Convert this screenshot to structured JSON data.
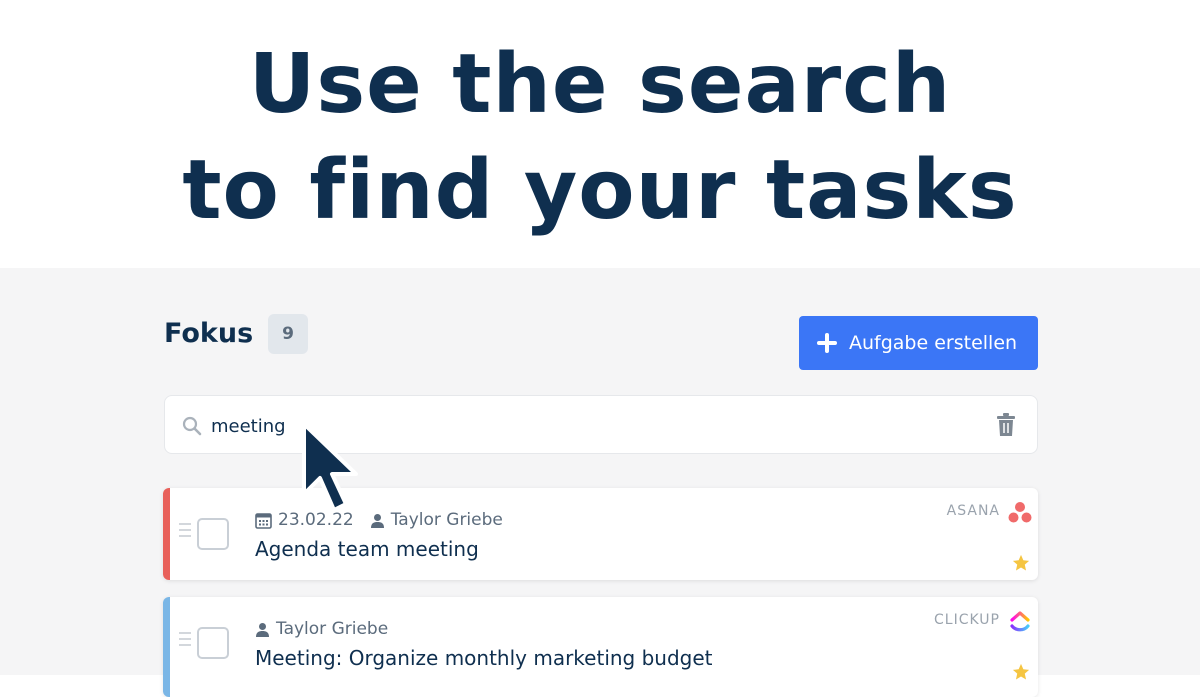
{
  "hero": {
    "line1": "Use the search",
    "line2": "to find your tasks"
  },
  "header": {
    "title": "Fokus",
    "count": "9",
    "create_button": "Aufgabe erstellen"
  },
  "search": {
    "value": "meeting",
    "icon": "search-icon",
    "clear_icon": "trash-icon"
  },
  "tasks": [
    {
      "date": "23.02.22",
      "assignee": "Taylor Griebe",
      "title": "Agenda team meeting",
      "source": "ASANA",
      "accent_color": "#e8605a",
      "starred": true
    },
    {
      "assignee": "Taylor Griebe",
      "title": "Meeting: Organize monthly marketing budget",
      "source": "CLICKUP",
      "accent_color": "#7ab6e6",
      "starred": true
    }
  ],
  "colors": {
    "primary": "#3b76f6",
    "heading": "#0f2f4f",
    "star": "#f5c542",
    "asana": "#f06a6a"
  }
}
